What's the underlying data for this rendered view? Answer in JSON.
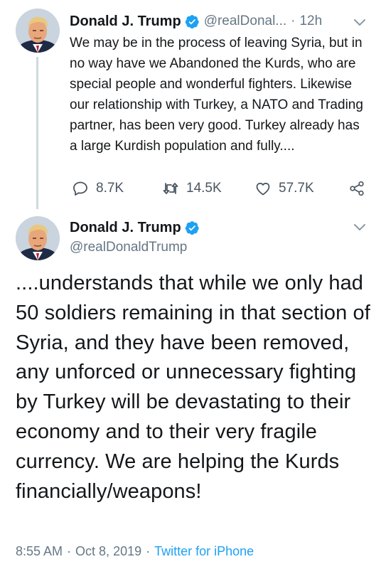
{
  "tweet1": {
    "name": "Donald J. Trump",
    "handle": "@realDonal...",
    "separator": "·",
    "time": "12h",
    "text": "We may be in the process of leaving Syria, but in no way have we Abandoned the Kurds, who are special people and wonderful fighters. Likewise our relationship with Turkey, a NATO and Trading partner, has been very good. Turkey already has a large Kurdish population and fully....",
    "actions": {
      "replies": "8.7K",
      "retweets": "14.5K",
      "likes": "57.7K"
    },
    "icons": {
      "reply": "reply-icon",
      "retweet": "retweet-icon",
      "like": "heart-icon",
      "share": "share-icon",
      "verified": "verified-badge-icon",
      "menu": "chevron-down-icon"
    }
  },
  "tweet2": {
    "name": "Donald J. Trump",
    "handle": "@realDonaldTrump",
    "text": "....understands that while we only had 50 soldiers remaining in that section of Syria, and they have been removed, any unforced or unnecessary fighting by Turkey will be devastating to their economy and to their very fragile currency. We are helping the Kurds financially/weapons!",
    "time": "8:55 AM",
    "separator": "·",
    "date": "Oct 8, 2019",
    "source": "Twitter for iPhone"
  },
  "colors": {
    "accent": "#1da1f2",
    "text": "#14171a",
    "secondary_text": "#657786",
    "thread_line": "#cfd9de"
  }
}
